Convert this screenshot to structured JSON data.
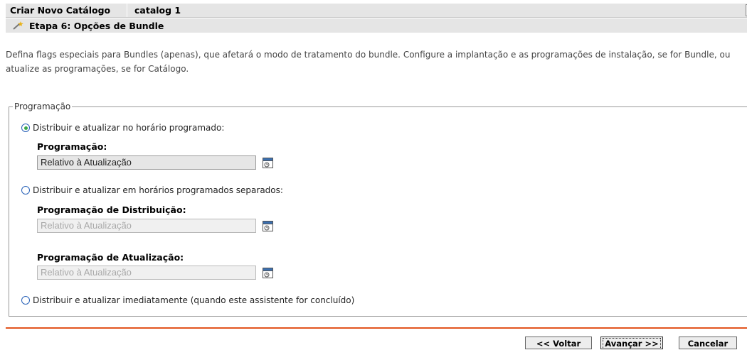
{
  "header": {
    "wizard_title": "Criar Novo Catálogo",
    "catalog_name": "catalog 1",
    "help_label": "?"
  },
  "step": {
    "title": "Etapa 6: Opções de Bundle"
  },
  "description": "Defina flags especiais para Bundles (apenas), que afetará o modo de tratamento do bundle. Configure a implantação e as programações de instalação, se for Bundle, ou atualize as programações, se for Catálogo.",
  "schedule_group": {
    "legend": "Programação",
    "option1": {
      "label": "Distribuir e atualizar no horário programado:",
      "selected": true,
      "field_label": "Programação:",
      "field_value": "Relativo à Atualização"
    },
    "option2": {
      "label": "Distribuir e atualizar em horários programados separados:",
      "selected": false,
      "distribution_label": "Programação de Distribuição:",
      "distribution_value": "Relativo à Atualização",
      "refresh_label": "Programação de Atualização:",
      "refresh_value": "Relativo à Atualização"
    },
    "option3": {
      "label": "Distribuir e atualizar imediatamente (quando este assistente for concluído)",
      "selected": false
    }
  },
  "buttons": {
    "back": "<< Voltar",
    "next": "Avançar >>",
    "cancel": "Cancelar"
  },
  "colors": {
    "accent_rule": "#e2541e",
    "radio_selected": "#39a84a",
    "header_bg": "#e5e5e5"
  }
}
